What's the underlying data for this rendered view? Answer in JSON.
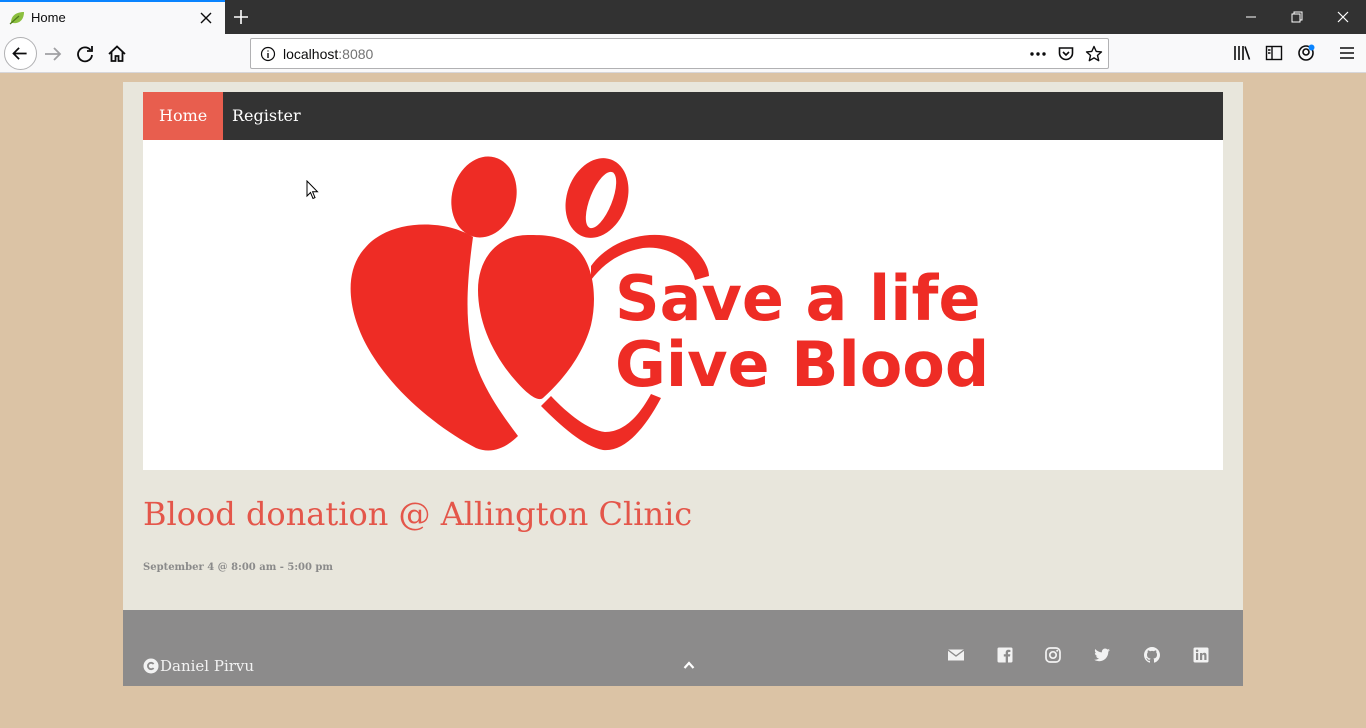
{
  "browser": {
    "tab_title": "Home",
    "url_host": "localhost",
    "url_port": ":8080"
  },
  "site": {
    "nav": [
      {
        "label": "Home",
        "active": true
      },
      {
        "label": "Register",
        "active": false
      }
    ],
    "hero": {
      "line1": "Save a life",
      "line2": "Give Blood",
      "color": "#ee2c25"
    },
    "event": {
      "title": "Blood donation @ Allington Clinic",
      "date": "September 4 @ 8:00 am - 5:00 pm"
    },
    "footer": {
      "copyright_name": "Daniel Pirvu",
      "icons": [
        "envelope-icon",
        "facebook-icon",
        "instagram-icon",
        "twitter-icon",
        "github-icon",
        "linkedin-icon"
      ]
    }
  },
  "colors": {
    "accent": "#e85e4e",
    "title": "#e4564a",
    "nav_bg": "#333333",
    "page_bg": "#dbc3a5",
    "footer_bg": "#8c8b8b"
  }
}
